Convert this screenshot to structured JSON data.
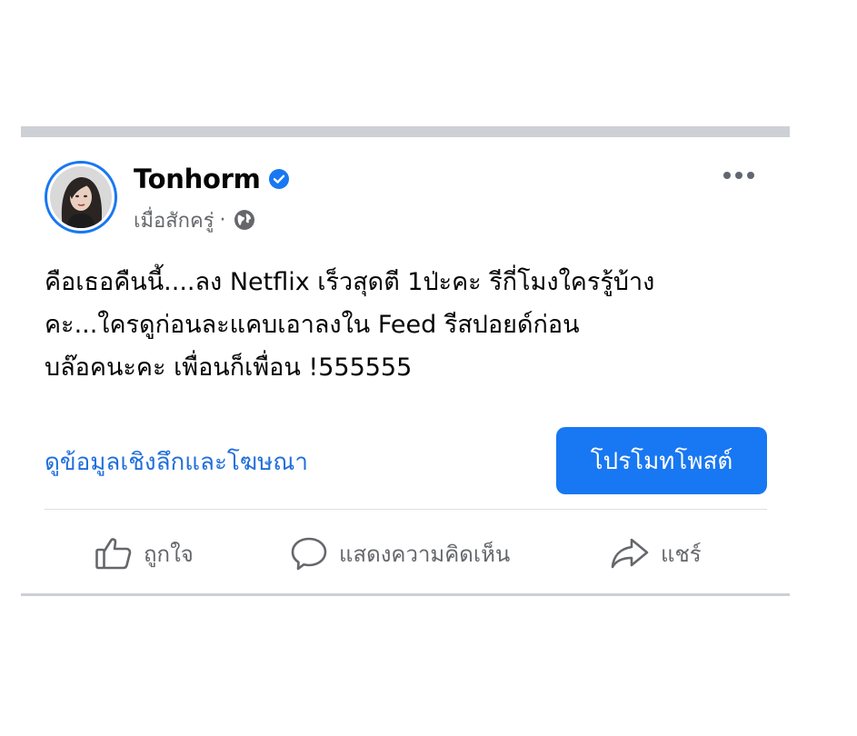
{
  "post": {
    "author": "Tonhorm",
    "timestamp": "เมื่อสักครู่",
    "meta_separator": "·",
    "text_lines": [
      "คือเธอคืนนี้....ลง Netflix เร็วสุดตี 1ป่ะคะ รีกี่โมงใครรู้บ้าง",
      "คะ...ใครดูก่อนละแคบเอาลงใน Feed รีสปอยด์ก่อน",
      "บล๊อคนะคะ เพื่อนก็เพื่อน !555555"
    ],
    "insights_label": "ดูข้อมูลเชิงลึกและโฆษณา",
    "promote_label": "โปรโมทโพสต์",
    "actions": {
      "like": "ถูกใจ",
      "comment": "แสดงความคิดเห็น",
      "share": "แชร์"
    }
  },
  "icons": {
    "verified": "verified-badge-icon",
    "audience": "globe-icon",
    "more": "more-options-icon",
    "like": "thumbs-up-icon",
    "comment": "comment-bubble-icon",
    "share": "share-arrow-icon"
  },
  "colors": {
    "accent": "#1877f2",
    "link": "#216fdb",
    "secondary_text": "#65676b",
    "divider": "#cdd0d4"
  }
}
